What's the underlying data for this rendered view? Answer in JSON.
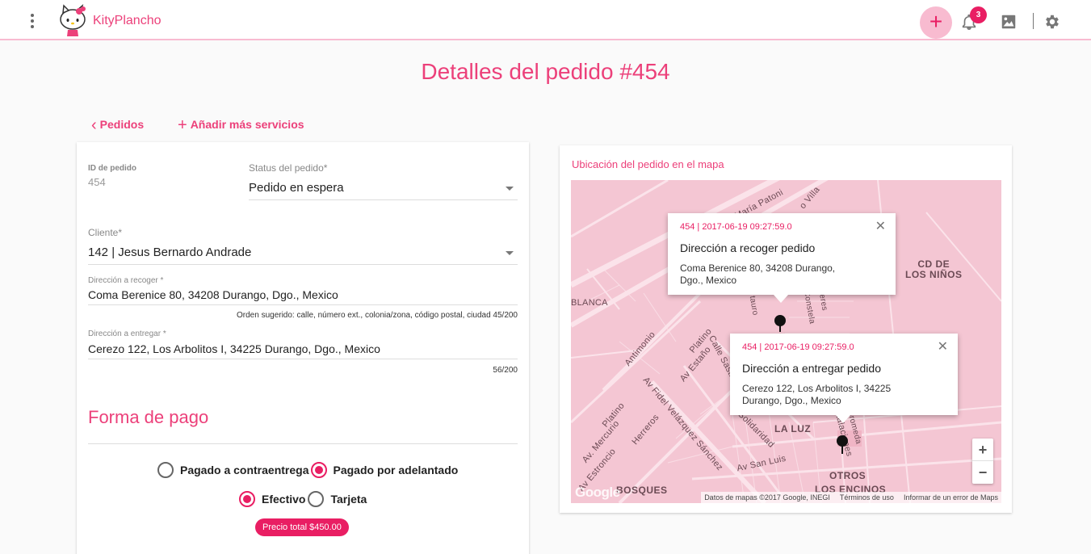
{
  "app": {
    "brand": "KityPlancho",
    "notifications_count": "3"
  },
  "page": {
    "title_prefix": "Detalles del pedido",
    "title_id": "#454"
  },
  "nav": {
    "back_label": "Pedidos",
    "add_services_label": "Añadir más servicios"
  },
  "form": {
    "order_id_label": "ID de pedido",
    "order_id_value": "454",
    "status_label": "Status del pedido*",
    "status_value": "Pedido en espera",
    "client_label": "Cliente*",
    "client_value": "142 | Jesus Bernardo Andrade",
    "pickup_label": "Dirección a recoger *",
    "pickup_value": "Coma Berenice 80, 34208 Durango, Dgo., Mexico",
    "pickup_hint": "Orden sugerido: calle, número ext., colonia/zona, código postal, ciudad 45/200",
    "delivery_label": "Dirección a entregar *",
    "delivery_value": "Cerezo 122, Los Arbolitos I, 34225 Durango, Dgo., Mexico",
    "delivery_counter": "56/200"
  },
  "payment": {
    "title": "Forma de pago",
    "cod_label": "Pagado a contraentrega",
    "prepaid_label": "Pagado por adelantado",
    "cash_label": "Efectivo",
    "card_label": "Tarjeta",
    "total_label": "Precio total $450.00",
    "selected_timing": "prepaid",
    "selected_method": "cash"
  },
  "map": {
    "title": "Ubicación del pedido en el mapa",
    "popup_pickup": {
      "id": "454 | 2017-06-19 09:27:59.0",
      "title": "Dirección a recoger pedido",
      "address_line1": "Coma Berenice 80, 34208 Durango,",
      "address_line2": "Dgo., Mexico"
    },
    "popup_delivery": {
      "id": "454 | 2017-06-19 09:27:59.0",
      "title": "Dirección a entregar pedido",
      "address_line1": "Cerezo 122, Los Arbolitos I, 34225",
      "address_line2": "Durango, Dgo., Mexico"
    },
    "streets": {
      "patoni": "María Patoni",
      "villa": "o Villa",
      "blanca": "BLANCA",
      "antimonio": "Antimonio",
      "estano": "Av Estaño",
      "platino1": "Platino",
      "sastres": "Calle Sastres",
      "fidel": "Av Fidel Velázquez Sánchez",
      "platino2": "Platino",
      "herreros": "Herreros",
      "mercurio": "Av. Mercurio",
      "estroncio": "Av Estroncio",
      "solidaridad": "Solidaridad",
      "sanluis": "Av San Luis",
      "instalaciones": "Instalaciones",
      "andromeda": "Andromeda",
      "constelacion": "Constela",
      "tauro": "tauro",
      "eres": "eres"
    },
    "places": {
      "cd_ninos_1": "CD DE",
      "cd_ninos_2": "LOS NIÑOS",
      "la_luz": "LA LUZ",
      "otros": "OTROS",
      "encinos": "LOS ENCINOS",
      "bosques": "BOSQUES"
    },
    "zoom_in": "+",
    "zoom_out": "−",
    "google": "Google",
    "footer_data": "Datos de mapas ©2017 Google, INEGI",
    "footer_terms": "Términos de uso",
    "footer_report": "Informar de un error de Maps"
  },
  "colors": {
    "accent": "#e91e63",
    "accent_light": "#f8bbd0",
    "map_bg": "#f4c6d3"
  },
  "icons": [
    "more-vert-icon",
    "hello-kitty-logo",
    "add-icon",
    "bell-icon",
    "image-icon",
    "gear-icon",
    "chevron-left-icon",
    "plus-icon",
    "dropdown-caret-icon",
    "close-icon",
    "map-pin-icon"
  ]
}
